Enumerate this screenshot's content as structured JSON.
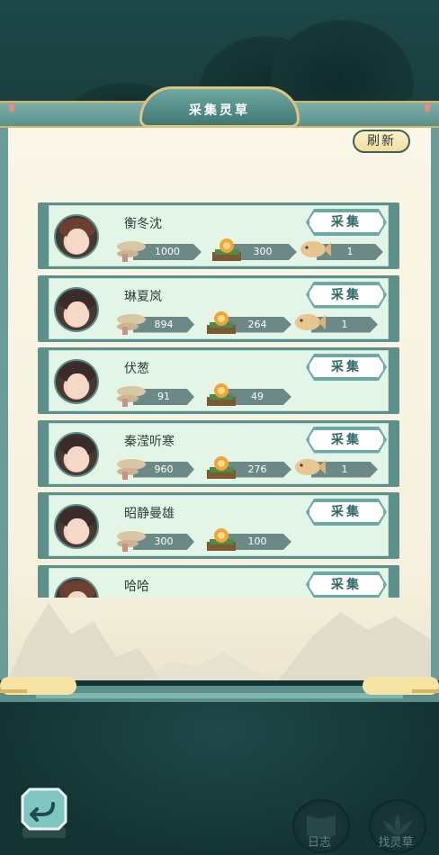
{
  "header": {
    "title": "采集灵草",
    "refresh_label": "刷新"
  },
  "collect_label": "采集",
  "players": [
    {
      "name": "衡冬沈",
      "herb": "1000",
      "pill": "300",
      "fish": "1",
      "avatar": "brown"
    },
    {
      "name": "琳夏岚",
      "herb": "894",
      "pill": "264",
      "fish": "1",
      "avatar": "dark"
    },
    {
      "name": "伏葱",
      "herb": "91",
      "pill": "49",
      "fish": null,
      "avatar": "dark"
    },
    {
      "name": "秦滢听寒",
      "herb": "960",
      "pill": "276",
      "fish": "1",
      "avatar": "dark"
    },
    {
      "name": "昭静曼雄",
      "herb": "300",
      "pill": "100",
      "fish": null,
      "avatar": "dark"
    },
    {
      "name": "哈哈",
      "herb": "",
      "pill": "",
      "fish": null,
      "avatar": "brown"
    }
  ],
  "footer": {
    "log_label": "日志",
    "find_label": "找灵草"
  },
  "colors": {
    "accent": "#5d8f8b",
    "card_bg": "#e2f5e6",
    "gold": "#e2c27a"
  }
}
